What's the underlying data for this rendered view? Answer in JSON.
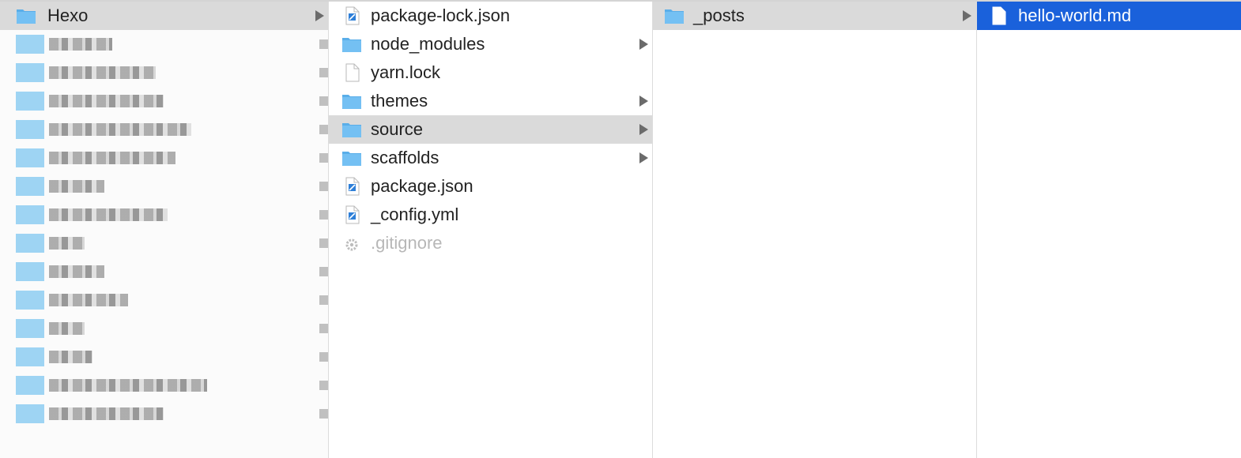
{
  "column_root": {
    "selected": {
      "name": "Hexo",
      "icon": "folder-icon"
    },
    "blurred_rows": 14
  },
  "column_hexo": {
    "items": [
      {
        "name": "package-lock.json",
        "icon": "json-file-icon",
        "has_children": false,
        "state": "normal"
      },
      {
        "name": "node_modules",
        "icon": "folder-icon",
        "has_children": true,
        "state": "normal"
      },
      {
        "name": "yarn.lock",
        "icon": "document-icon",
        "has_children": false,
        "state": "normal"
      },
      {
        "name": "themes",
        "icon": "folder-icon",
        "has_children": true,
        "state": "normal"
      },
      {
        "name": "source",
        "icon": "folder-icon",
        "has_children": true,
        "state": "selected"
      },
      {
        "name": "scaffolds",
        "icon": "folder-icon",
        "has_children": true,
        "state": "normal"
      },
      {
        "name": "package.json",
        "icon": "json-file-icon",
        "has_children": false,
        "state": "normal"
      },
      {
        "name": "_config.yml",
        "icon": "yml-file-icon",
        "has_children": false,
        "state": "normal"
      },
      {
        "name": ".gitignore",
        "icon": "gear-icon",
        "has_children": false,
        "state": "hidden"
      }
    ]
  },
  "column_source": {
    "items": [
      {
        "name": "_posts",
        "icon": "folder-icon",
        "has_children": true,
        "state": "selected"
      }
    ]
  },
  "column_posts": {
    "items": [
      {
        "name": "hello-world.md",
        "icon": "document-icon",
        "has_children": false,
        "state": "active"
      }
    ]
  },
  "colors": {
    "folder": "#74c0f3",
    "folder_tab": "#5aaee9",
    "selection_gray": "#dadada",
    "selection_blue": "#1a61db",
    "hidden_text": "#b7b7b7"
  }
}
